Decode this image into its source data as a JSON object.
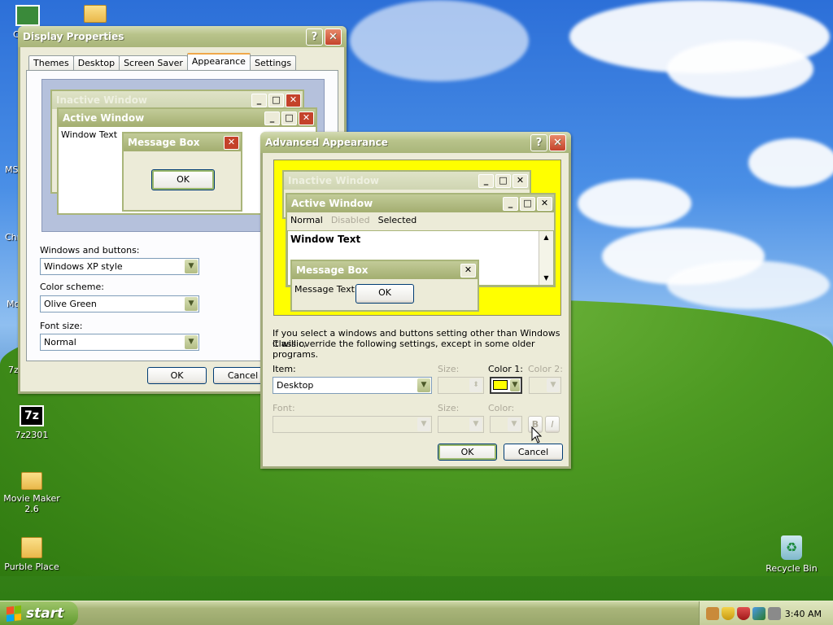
{
  "desktop": {
    "icons": [
      {
        "label": "C",
        "icon": "green-icon"
      },
      {
        "label": "",
        "icon": "folder-icon"
      },
      {
        "label": "MS",
        "icon": "none"
      },
      {
        "label": "Chr",
        "icon": "none"
      },
      {
        "label": "Mo",
        "icon": "none"
      },
      {
        "label": "7z",
        "icon": "none"
      },
      {
        "label": "7z2301",
        "icon": "7z-icon"
      },
      {
        "label": "Movie Maker 2.6",
        "icon": "folder-icon"
      },
      {
        "label": "Purble Place",
        "icon": "zip-folder-icon"
      },
      {
        "label": "Recycle Bin",
        "icon": "recycle-bin-icon"
      }
    ]
  },
  "display_properties": {
    "title": "Display Properties",
    "tabs": [
      "Themes",
      "Desktop",
      "Screen Saver",
      "Appearance",
      "Settings"
    ],
    "active_tab": "Appearance",
    "preview": {
      "inactive_title": "Inactive Window",
      "active_title": "Active Window",
      "window_text": "Window Text",
      "msgbox_title": "Message Box",
      "ok": "OK"
    },
    "windows_buttons_label": "Windows and buttons:",
    "windows_buttons_value": "Windows XP style",
    "color_scheme_label": "Color scheme:",
    "color_scheme_value": "Olive Green",
    "font_size_label": "Font size:",
    "font_size_value": "Normal",
    "ok": "OK",
    "cancel": "Cancel"
  },
  "advanced": {
    "title": "Advanced Appearance",
    "preview": {
      "inactive_title": "Inactive Window",
      "active_title": "Active Window",
      "menu": [
        "Normal",
        "Disabled",
        "Selected"
      ],
      "window_text": "Window Text",
      "msgbox_title": "Message Box",
      "msg_text": "Message Text",
      "ok": "OK",
      "bg_color": "#ffff00"
    },
    "info_line1": "If you select a windows and buttons setting other than Windows Classic,",
    "info_line2": "it will override the following settings, except in some older programs.",
    "item_label": "Item:",
    "item_value": "Desktop",
    "size_label": "Size:",
    "color1_label": "Color 1:",
    "color2_label": "Color 2:",
    "font_label": "Font:",
    "size2_label": "Size:",
    "color_label": "Color:",
    "bold": "B",
    "italic": "I",
    "color1_value": "#ffff00",
    "ok": "OK",
    "cancel": "Cancel"
  },
  "taskbar": {
    "start": "start",
    "clock": "3:40 AM"
  }
}
